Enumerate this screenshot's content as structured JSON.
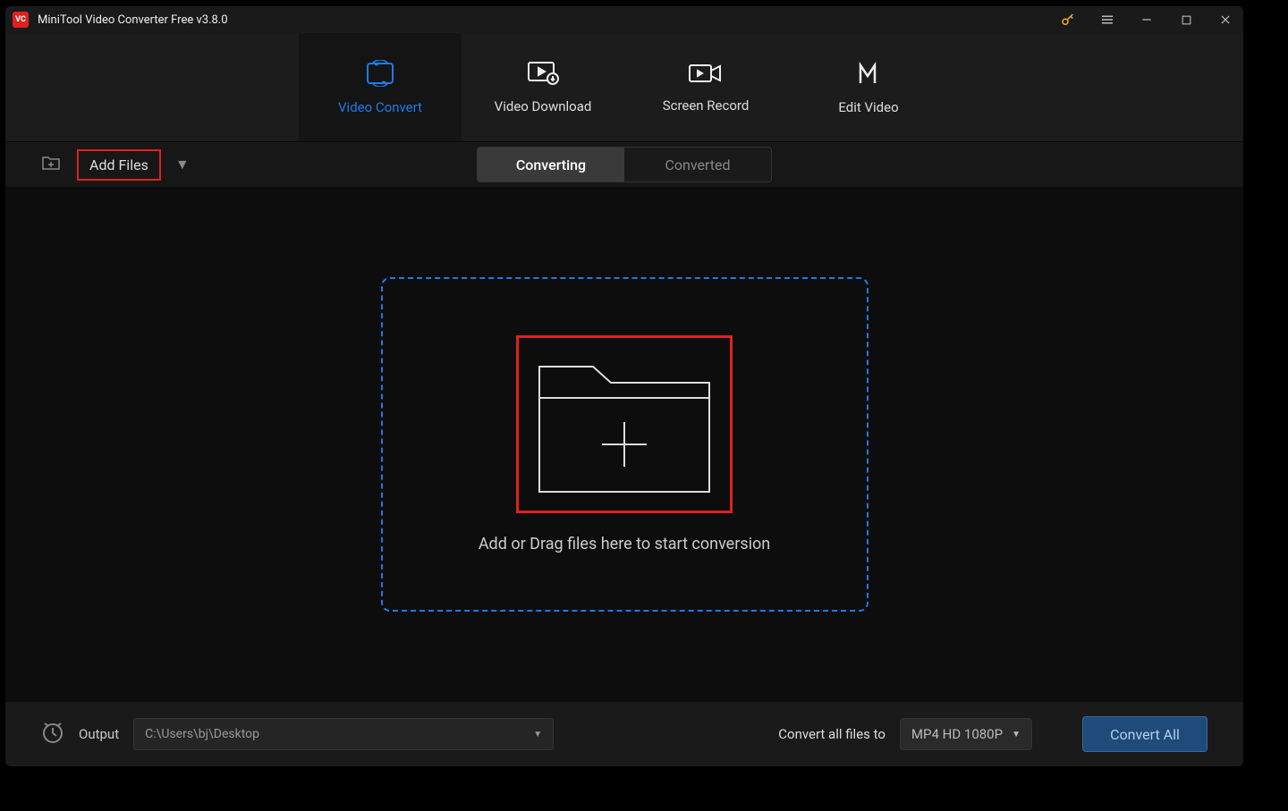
{
  "app": {
    "title": "MiniTool Video Converter Free v3.8.0",
    "logo_text": "VC"
  },
  "nav": {
    "tabs": [
      {
        "label": "Video Convert"
      },
      {
        "label": "Video Download"
      },
      {
        "label": "Screen Record"
      },
      {
        "label": "Edit Video"
      }
    ]
  },
  "toolbar": {
    "add_files_label": "Add Files",
    "segments": [
      {
        "label": "Converting"
      },
      {
        "label": "Converted"
      }
    ]
  },
  "dropzone": {
    "text": "Add or Drag files here to start conversion"
  },
  "footer": {
    "output_label": "Output",
    "output_path": "C:\\Users\\bj\\Desktop",
    "convert_to_label": "Convert all files to",
    "format": "MP4 HD 1080P",
    "convert_button": "Convert All"
  }
}
